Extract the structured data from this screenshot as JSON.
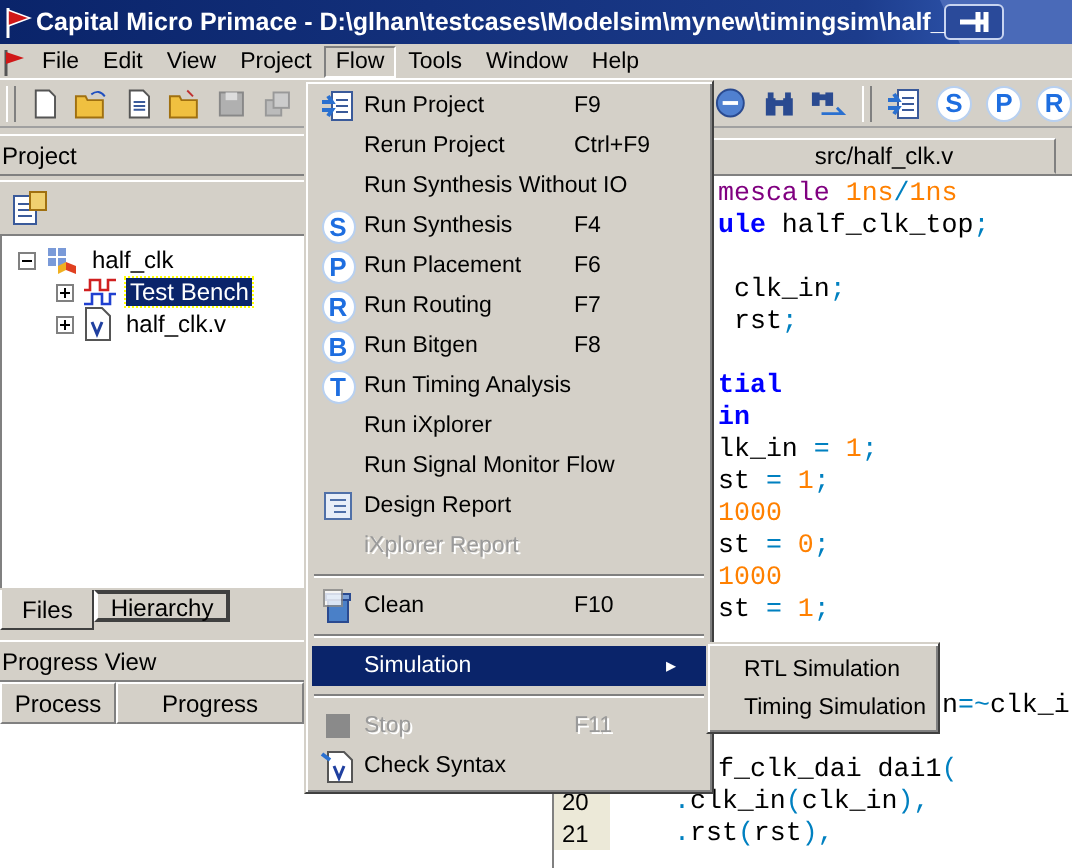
{
  "window": {
    "title": "Capital Micro Primace - D:\\glhan\\testcases\\Modelsim\\mynew\\timingsim\\half_"
  },
  "menubar": [
    {
      "label": "File",
      "selected": false
    },
    {
      "label": "Edit",
      "selected": false
    },
    {
      "label": "View",
      "selected": false
    },
    {
      "label": "Project",
      "selected": false
    },
    {
      "label": "Flow",
      "selected": true
    },
    {
      "label": "Tools",
      "selected": false
    },
    {
      "label": "Window",
      "selected": false
    },
    {
      "label": "Help",
      "selected": false
    }
  ],
  "toolbar_right": {
    "badges": [
      "S",
      "P",
      "R"
    ]
  },
  "project_panel": {
    "title": "Project",
    "tree": [
      {
        "label": "half_clk",
        "expanded": true,
        "selected": false,
        "children": [
          {
            "label": "Test Bench",
            "expanded": false,
            "selected": true
          },
          {
            "label": "half_clk.v",
            "expanded": false,
            "selected": false
          }
        ]
      }
    ],
    "tabs": [
      {
        "label": "Files",
        "selected": true
      },
      {
        "label": "Hierarchy",
        "selected": false
      }
    ]
  },
  "progress_panel": {
    "title": "Progress View",
    "columns": [
      "Process",
      "Progress"
    ]
  },
  "editor": {
    "tab": "src/half_clk.v",
    "lines": [
      {
        "kind": "tail",
        "segments": [
          {
            "text": "mescale",
            "kind": "directive"
          },
          {
            "text": " 1ns",
            "kind": "number"
          },
          {
            "text": "/",
            "kind": "symbol"
          },
          {
            "text": "1ns",
            "kind": "number"
          }
        ]
      },
      {
        "kind": "tail",
        "segments": [
          {
            "text": "ule",
            "kind": "keyword"
          },
          {
            "text": " half_clk_top",
            "kind": "plain"
          },
          {
            "text": ";",
            "kind": "symbol"
          }
        ]
      },
      {
        "kind": "blank"
      },
      {
        "kind": "tail",
        "segments": [
          {
            "text": " clk_in",
            "kind": "plain"
          },
          {
            "text": ";",
            "kind": "symbol"
          }
        ]
      },
      {
        "kind": "tail",
        "segments": [
          {
            "text": " rst",
            "kind": "plain"
          },
          {
            "text": ";",
            "kind": "symbol"
          }
        ]
      },
      {
        "kind": "blank"
      },
      {
        "kind": "tail",
        "segments": [
          {
            "text": "tial",
            "kind": "keyword"
          }
        ]
      },
      {
        "kind": "tail",
        "segments": [
          {
            "text": "in",
            "kind": "keyword"
          }
        ]
      },
      {
        "kind": "tail",
        "segments": [
          {
            "text": "lk_in ",
            "kind": "plain"
          },
          {
            "text": "=",
            "kind": "symbol"
          },
          {
            "text": " 1",
            "kind": "number"
          },
          {
            "text": ";",
            "kind": "symbol"
          }
        ]
      },
      {
        "kind": "tail",
        "segments": [
          {
            "text": "st ",
            "kind": "plain"
          },
          {
            "text": "=",
            "kind": "symbol"
          },
          {
            "text": " 1",
            "kind": "number"
          },
          {
            "text": ";",
            "kind": "symbol"
          }
        ]
      },
      {
        "kind": "tail",
        "segments": [
          {
            "text": "1000",
            "kind": "number"
          }
        ]
      },
      {
        "kind": "tail",
        "segments": [
          {
            "text": "st ",
            "kind": "plain"
          },
          {
            "text": "=",
            "kind": "symbol"
          },
          {
            "text": " 0",
            "kind": "number"
          },
          {
            "text": ";",
            "kind": "symbol"
          }
        ]
      },
      {
        "kind": "tail",
        "segments": [
          {
            "text": "1000",
            "kind": "number"
          }
        ]
      },
      {
        "kind": "tail",
        "segments": [
          {
            "text": "st ",
            "kind": "plain"
          },
          {
            "text": "=",
            "kind": "symbol"
          },
          {
            "text": " 1",
            "kind": "number"
          },
          {
            "text": ";",
            "kind": "symbol"
          }
        ]
      },
      {
        "kind": "blank"
      },
      {
        "kind": "blank"
      },
      {
        "kind": "far_tail",
        "segments": [
          {
            "text": "n",
            "kind": "plain"
          },
          {
            "text": "=~",
            "kind": "symbol"
          },
          {
            "text": "clk_i",
            "kind": "plain"
          }
        ]
      },
      {
        "kind": "blank"
      },
      {
        "kind": "tail",
        "segments": [
          {
            "text": "f_clk_dai dai1",
            "kind": "plain"
          },
          {
            "text": "(",
            "kind": "symbol"
          }
        ]
      },
      {
        "kind": "line",
        "number": "20",
        "segments": [
          {
            "text": ".",
            "kind": "symbol"
          },
          {
            "text": "clk_in",
            "kind": "plain"
          },
          {
            "text": "(",
            "kind": "symbol"
          },
          {
            "text": "clk_in",
            "kind": "plain"
          },
          {
            "text": "),",
            "kind": "symbol"
          }
        ]
      },
      {
        "kind": "line",
        "number": "21",
        "segments": [
          {
            "text": ".",
            "kind": "symbol"
          },
          {
            "text": "rst",
            "kind": "plain"
          },
          {
            "text": "(",
            "kind": "symbol"
          },
          {
            "text": "rst",
            "kind": "plain"
          },
          {
            "text": "),",
            "kind": "symbol"
          }
        ]
      }
    ]
  },
  "flow_menu": {
    "items": [
      {
        "kind": "item",
        "label": "Run Project",
        "shortcut": "F9",
        "disabled": false,
        "selected": false
      },
      {
        "kind": "item",
        "label": "Rerun Project",
        "shortcut": "Ctrl+F9",
        "disabled": false,
        "selected": false
      },
      {
        "kind": "item",
        "label": "Run Synthesis Without IO",
        "disabled": false,
        "selected": false
      },
      {
        "kind": "item",
        "label": "Run Synthesis",
        "shortcut": "F4",
        "badge": "S",
        "disabled": false,
        "selected": false
      },
      {
        "kind": "item",
        "label": "Run Placement",
        "shortcut": "F6",
        "badge": "P",
        "disabled": false,
        "selected": false
      },
      {
        "kind": "item",
        "label": "Run Routing",
        "shortcut": "F7",
        "badge": "R",
        "disabled": false,
        "selected": false
      },
      {
        "kind": "item",
        "label": "Run Bitgen",
        "shortcut": "F8",
        "badge": "B",
        "disabled": false,
        "selected": false
      },
      {
        "kind": "item",
        "label": "Run Timing Analysis",
        "badge": "T",
        "disabled": false,
        "selected": false
      },
      {
        "kind": "item",
        "label": "Run iXplorer",
        "disabled": false,
        "selected": false
      },
      {
        "kind": "item",
        "label": "Run Signal Monitor Flow",
        "disabled": false,
        "selected": false
      },
      {
        "kind": "item",
        "label": "Design Report",
        "disabled": false,
        "selected": false
      },
      {
        "kind": "item",
        "label": "iXplorer Report",
        "disabled": true,
        "selected": false
      },
      {
        "kind": "separator"
      },
      {
        "kind": "item",
        "label": "Clean",
        "shortcut": "F10",
        "disabled": false,
        "selected": false
      },
      {
        "kind": "separator"
      },
      {
        "kind": "submenu",
        "label": "Simulation",
        "arrow": "▸",
        "disabled": false,
        "selected": true
      },
      {
        "kind": "separator"
      },
      {
        "kind": "item",
        "label": "Stop",
        "shortcut": "F11",
        "disabled": true,
        "selected": false
      },
      {
        "kind": "item",
        "label": "Check Syntax",
        "disabled": false,
        "selected": false
      }
    ]
  },
  "simulation_submenu": [
    {
      "label": "RTL Simulation",
      "selected": false
    },
    {
      "label": "Timing Simulation",
      "selected": false
    }
  ]
}
